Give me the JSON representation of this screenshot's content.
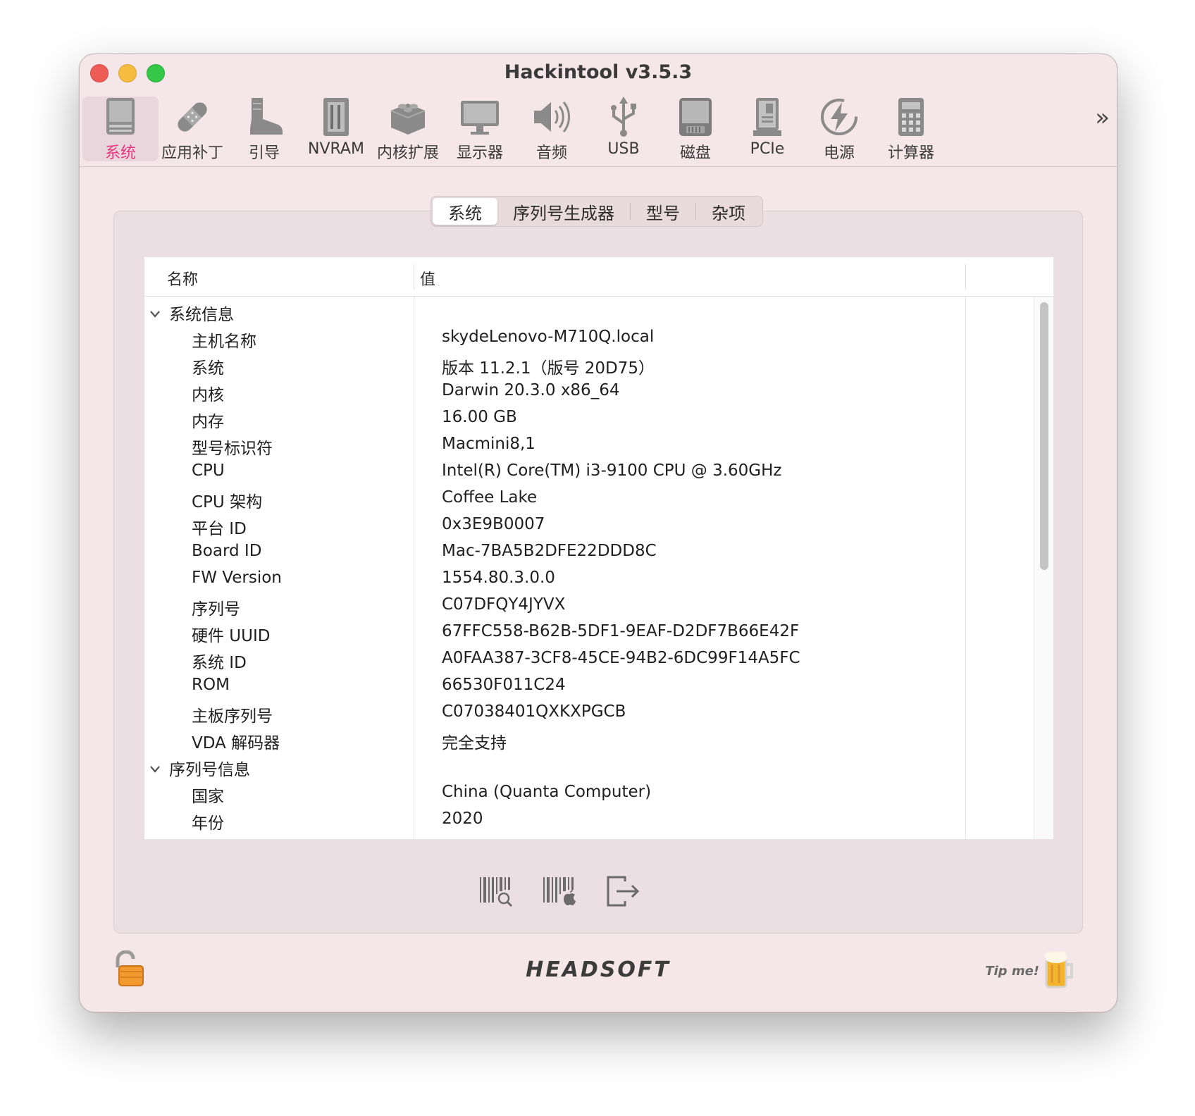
{
  "window": {
    "title": "Hackintool v3.5.3"
  },
  "toolbar": {
    "items": [
      {
        "label": "系统",
        "icon": "computer-icon"
      },
      {
        "label": "应用补丁",
        "icon": "bandage-icon"
      },
      {
        "label": "引导",
        "icon": "boot-icon"
      },
      {
        "label": "NVRAM",
        "icon": "memory-chip-icon"
      },
      {
        "label": "内核扩展",
        "icon": "lego-brick-icon"
      },
      {
        "label": "显示器",
        "icon": "monitor-icon"
      },
      {
        "label": "音频",
        "icon": "speaker-icon"
      },
      {
        "label": "USB",
        "icon": "usb-icon"
      },
      {
        "label": "磁盘",
        "icon": "disk-icon"
      },
      {
        "label": "PCIe",
        "icon": "pcie-card-icon"
      },
      {
        "label": "电源",
        "icon": "power-bolt-icon"
      },
      {
        "label": "计算器",
        "icon": "calculator-icon"
      }
    ],
    "more": "»",
    "active_color": "#e8367e"
  },
  "tabs": [
    "系统",
    "序列号生成器",
    "型号",
    "杂项"
  ],
  "table": {
    "col_name": "名称",
    "col_value": "值",
    "rows": [
      {
        "name": "系统信息",
        "value": "",
        "group": true
      },
      {
        "name": "主机名称",
        "value": "skydeLenovo-M710Q.local"
      },
      {
        "name": "系统",
        "value": " 版本 11.2.1（版号 20D75）"
      },
      {
        "name": "内核",
        "value": "Darwin 20.3.0 x86_64"
      },
      {
        "name": "内存",
        "value": "16.00 GB"
      },
      {
        "name": "型号标识符",
        "value": "Macmini8,1"
      },
      {
        "name": "CPU",
        "value": "Intel(R) Core(TM) i3-9100 CPU @ 3.60GHz"
      },
      {
        "name": "CPU 架构",
        "value": "Coffee Lake"
      },
      {
        "name": "平台 ID",
        "value": "0x3E9B0007"
      },
      {
        "name": "Board ID",
        "value": "Mac-7BA5B2DFE22DDD8C"
      },
      {
        "name": "FW Version",
        "value": "1554.80.3.0.0"
      },
      {
        "name": "序列号",
        "value": "C07DFQY4JYVX"
      },
      {
        "name": "硬件 UUID",
        "value": "67FFC558-B62B-5DF1-9EAF-D2DF7B66E42F"
      },
      {
        "name": "系统 ID",
        "value": "A0FAA387-3CF8-45CE-94B2-6DC99F14A5FC"
      },
      {
        "name": "ROM",
        "value": "66530F011C24"
      },
      {
        "name": "主板序列号",
        "value": "C07038401QXKXPGCB"
      },
      {
        "name": "VDA 解码器",
        "value": "完全支持"
      },
      {
        "name": "序列号信息",
        "value": "",
        "group": true
      },
      {
        "name": "国家",
        "value": "China (Quanta Computer)"
      },
      {
        "name": "年份",
        "value": "2020"
      }
    ]
  },
  "actions": [
    {
      "icon": "barcode-search-icon"
    },
    {
      "icon": "barcode-apple-icon"
    },
    {
      "icon": "export-icon"
    }
  ],
  "footer": {
    "lock_icon": "unlocked-padlock-icon",
    "brand": "HEADSOFT",
    "tip": "Tip me!",
    "beer_icon": "beer-mug-icon"
  }
}
